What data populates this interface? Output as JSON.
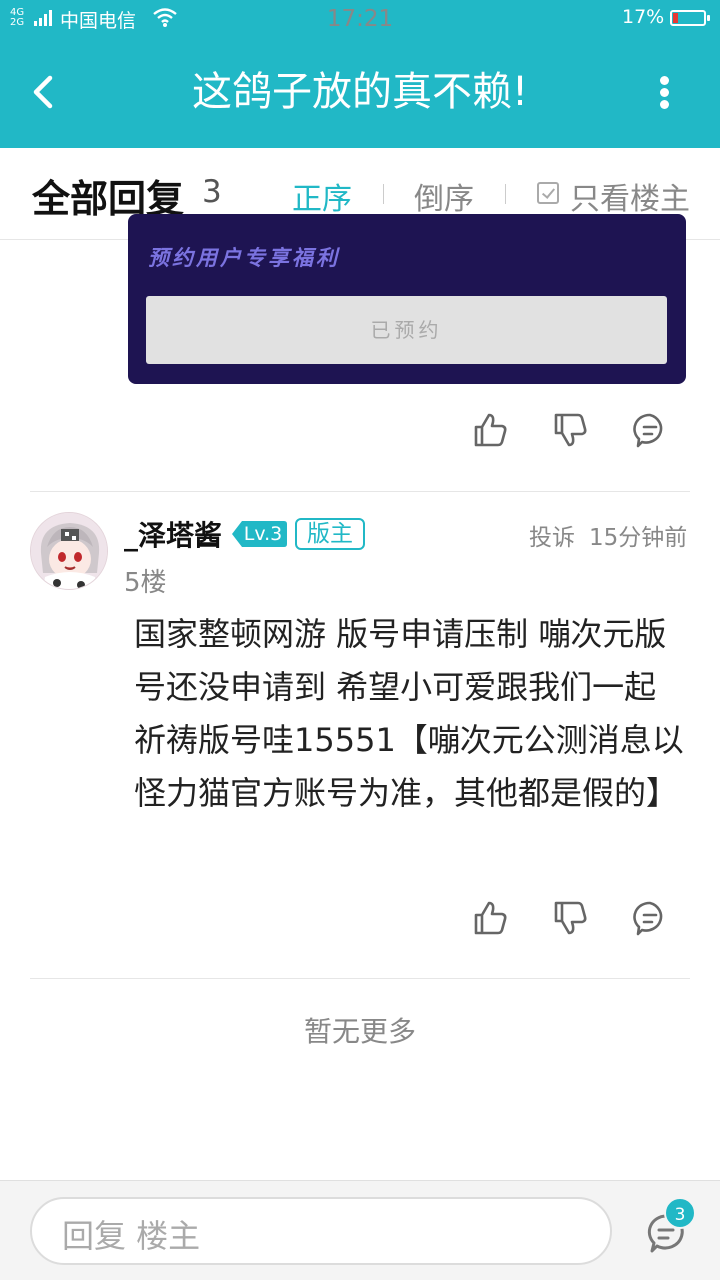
{
  "status_bar": {
    "network": "4G",
    "network2": "2G",
    "carrier": "中国电信",
    "time": "17:21",
    "battery_percent": "17%",
    "battery_level": 0.17
  },
  "header": {
    "title": "这鸽子放的真不赖!",
    "back_icon": "chevron-left-icon",
    "more_icon": "more-vertical-icon"
  },
  "reply_header": {
    "label": "全部回复",
    "count": "3",
    "sort_asc": "正序",
    "sort_desc": "倒序",
    "only_host": "只看楼主"
  },
  "promo": {
    "text": "预约用户专享福利",
    "button": "已预约"
  },
  "post": {
    "username": "_泽塔酱",
    "level": "Lv.3",
    "badge": "版主",
    "report": "投诉",
    "time": "15分钟前",
    "floor": "5楼",
    "content": "国家整顿网游 版号申请压制 嘣次元版号还没申请到 希望小可爱跟我们一起祈祷版号哇15551【嘣次元公测消息以怪力猫官方账号为准，其他都是假的】"
  },
  "footer": {
    "no_more": "暂无更多"
  },
  "bottom_bar": {
    "placeholder": "回复  楼主",
    "comment_count": "3"
  },
  "colors": {
    "accent": "#21b8c6",
    "promo_bg": "#1e1452",
    "promo_text": "#7b73e0"
  }
}
